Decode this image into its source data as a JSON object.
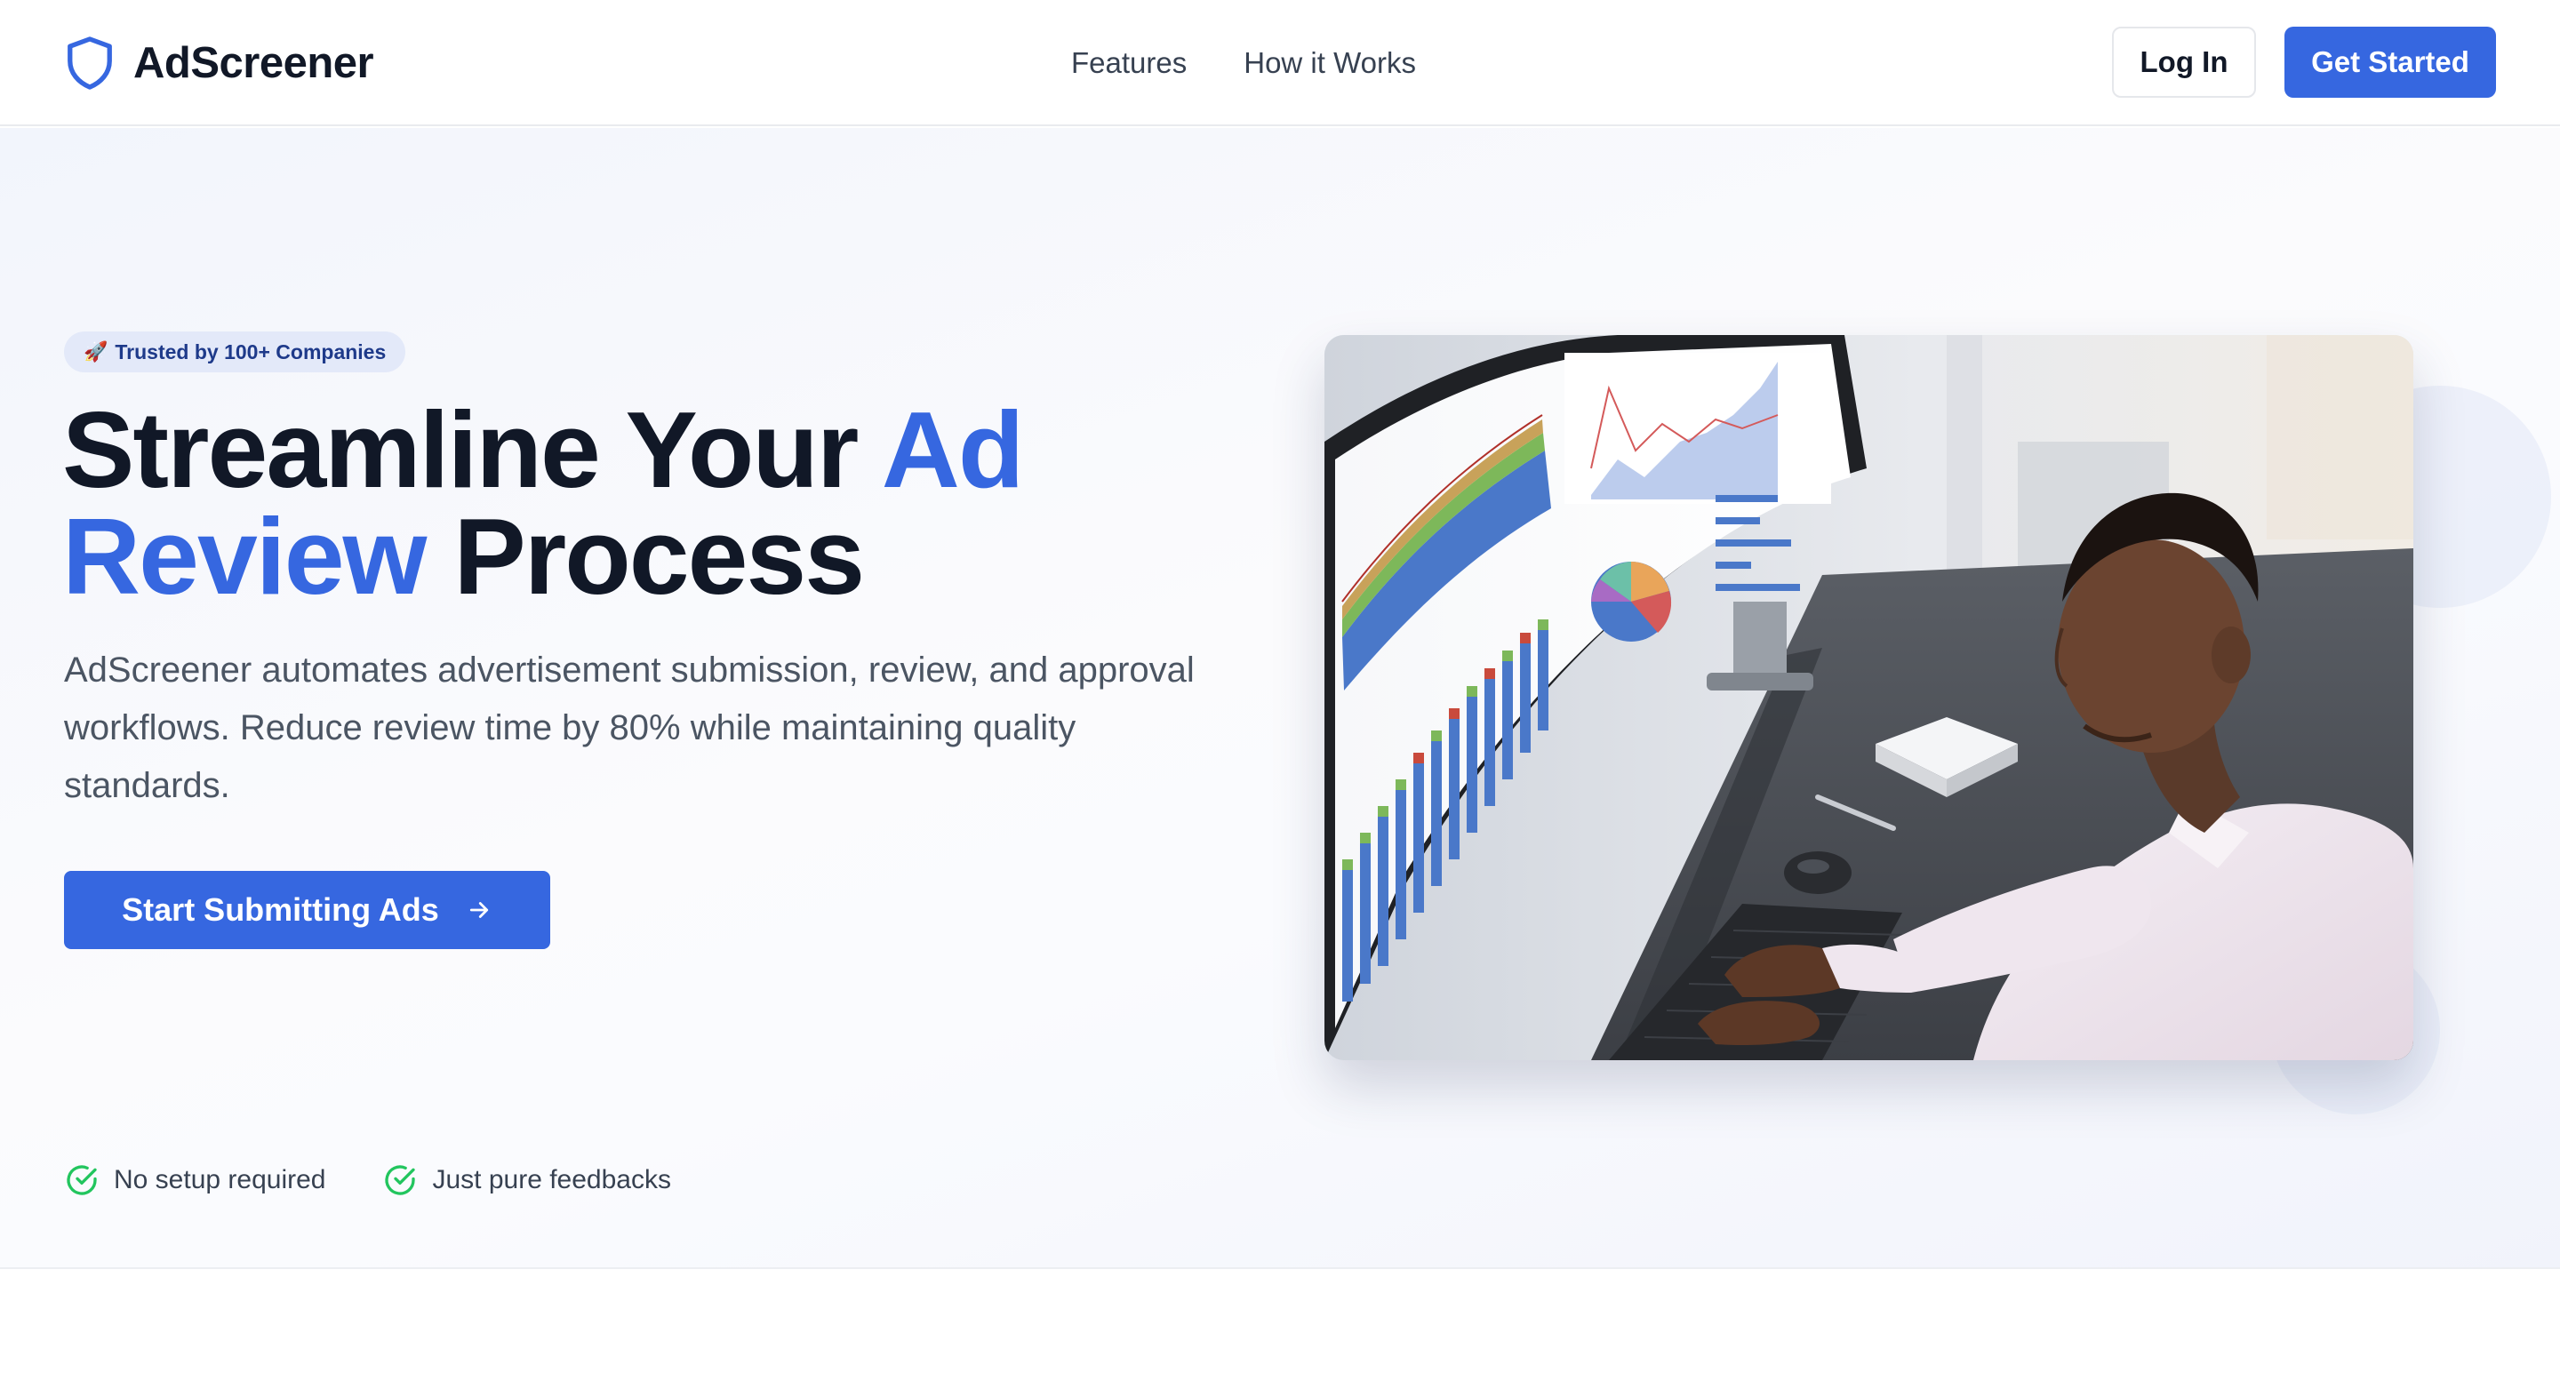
{
  "navbar": {
    "brand_name": "AdScreener",
    "links": [
      "Features",
      "How it Works"
    ],
    "login_label": "Log In",
    "get_started_label": "Get Started"
  },
  "hero": {
    "badge_icon": "🚀",
    "badge_text": "Trusted by 100+ Companies",
    "title": {
      "part1": "Streamline Your ",
      "accent1": "Ad",
      "accent2": "Review",
      "part2": " Process"
    },
    "description": "AdScreener automates advertisement submission, review, and approval workflows. Reduce review time by 80% while maintaining quality standards.",
    "cta_label": "Start Submitting Ads",
    "checks": [
      "No setup required",
      "Just pure feedbacks"
    ],
    "image_subject": "man-analyzing-charts-on-curved-monitor"
  },
  "colors": {
    "accent": "#3667e0",
    "heading": "#111827",
    "body_text": "#4b5563",
    "check_green": "#22c55e",
    "badge_bg": "#e3e9f9"
  },
  "icons": {
    "brand": "shield-icon",
    "cta": "arrow-right-icon",
    "check": "check-circle-icon",
    "badge": "rocket-icon"
  }
}
